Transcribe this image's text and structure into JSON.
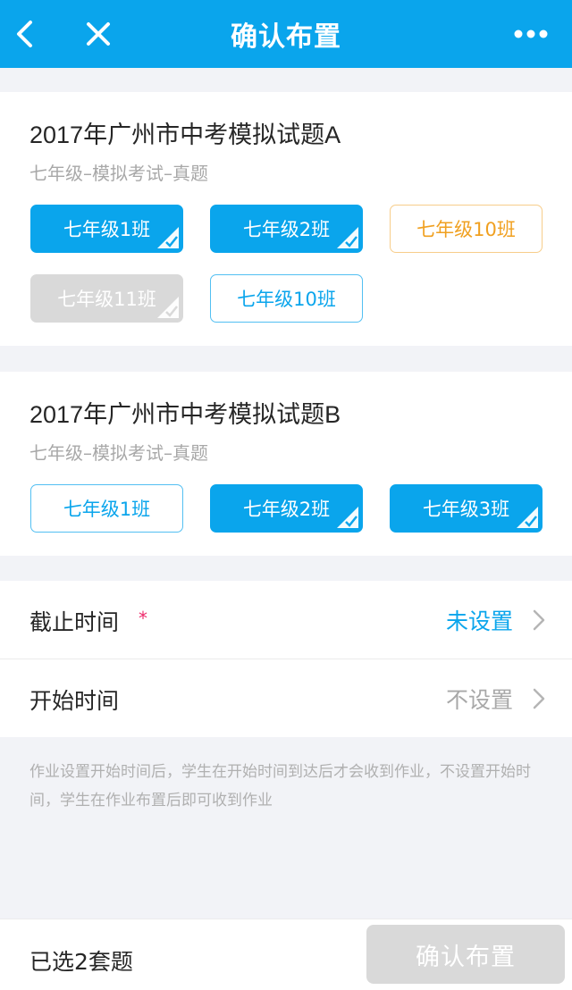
{
  "header": {
    "title": "确认布置",
    "back_icon": "chevron-left-icon",
    "close_icon": "close-icon",
    "more_icon": "more-horizontal-icon"
  },
  "colors": {
    "accent": "#0aa5ec",
    "selected_bg": "#0aa5ec",
    "warning": "#f0a020",
    "disabled": "#d9d9d9",
    "required_star": "#ee2b6b"
  },
  "papers": [
    {
      "title": "2017年广州市中考模拟试题A",
      "subtitle": "七年级–模拟考试–真题",
      "classes": [
        {
          "label": "七年级1班",
          "state": "selected"
        },
        {
          "label": "七年级2班",
          "state": "selected"
        },
        {
          "label": "七年级10班",
          "state": "warning"
        },
        {
          "label": "七年级11班",
          "state": "disabled"
        },
        {
          "label": "七年级10班",
          "state": "unselected"
        }
      ]
    },
    {
      "title": "2017年广州市中考模拟试题B",
      "subtitle": "七年级–模拟考试–真题",
      "classes": [
        {
          "label": "七年级1班",
          "state": "unselected"
        },
        {
          "label": "七年级2班",
          "state": "selected"
        },
        {
          "label": "七年级3班",
          "state": "selected"
        }
      ]
    }
  ],
  "settings": {
    "deadline": {
      "label": "截止时间",
      "required_mark": "*",
      "value": "未设置"
    },
    "start_time": {
      "label": "开始时间",
      "value": "不设置"
    }
  },
  "hint_text": "作业设置开始时间后，学生在开始时间到达后才会收到作业，不设置开始时间，学生在作业布置后即可收到作业",
  "footer": {
    "selected_count_text": "已选2套题",
    "confirm_label": "确认布置"
  }
}
